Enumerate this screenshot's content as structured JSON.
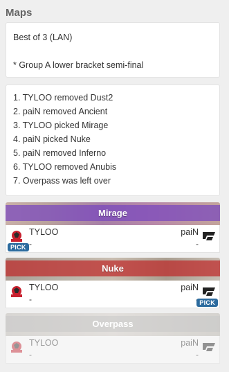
{
  "header": {
    "title": "Maps"
  },
  "info": {
    "format": "Best of 3 (LAN)",
    "note": "* Group A lower bracket semi-final"
  },
  "veto": [
    "1. TYLOO removed Dust2",
    "2. paiN removed Ancient",
    "3. TYLOO picked Mirage",
    "4. paiN picked Nuke",
    "5. paiN removed Inferno",
    "6. TYLOO removed Anubis",
    "7. Overpass was left over"
  ],
  "maps": [
    {
      "name": "Mirage",
      "team1": "TYLOO",
      "team2": "paiN",
      "score1": "-",
      "score2": "-",
      "pick_label": "PICK"
    },
    {
      "name": "Nuke",
      "team1": "TYLOO",
      "team2": "paiN",
      "score1": "-",
      "score2": "-",
      "pick_label": "PICK"
    },
    {
      "name": "Overpass",
      "team1": "TYLOO",
      "team2": "paiN",
      "score1": "-",
      "score2": "-"
    }
  ],
  "colors": {
    "pick_badge": "#2c6b9e",
    "tyloo_pick_band": "#7846be",
    "pain_pick_band": "#be2828"
  },
  "icons": {
    "team1_logo": "tyloo-logo-icon",
    "team2_logo": "pain-logo-icon"
  }
}
